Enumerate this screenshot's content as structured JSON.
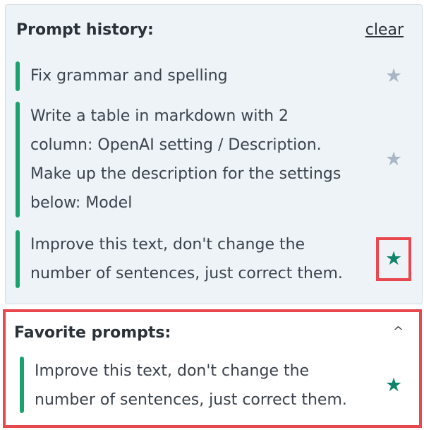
{
  "history": {
    "title": "Prompt history:",
    "clear_label": "clear",
    "items": [
      {
        "text": "Fix grammar and spelling",
        "favorite": false
      },
      {
        "text": "Write a table in markdown with 2 column: OpenAI setting / Description. Make up the description for the settings below: Model",
        "favorite": false
      },
      {
        "text": "Improve this text, don't change the number of sentences, just correct them.",
        "favorite": true
      }
    ]
  },
  "favorites": {
    "title": "Favorite prompts:",
    "items": [
      {
        "text": "Improve this text, don't change the number of sentences, just correct them.",
        "favorite": true
      }
    ]
  },
  "icons": {
    "star": "★",
    "chevron_up": "^"
  },
  "colors": {
    "accent_bar": "#1aa36f",
    "star_active": "#12836a",
    "star_inactive": "#a8b6c6",
    "highlight": "#e8474d"
  }
}
